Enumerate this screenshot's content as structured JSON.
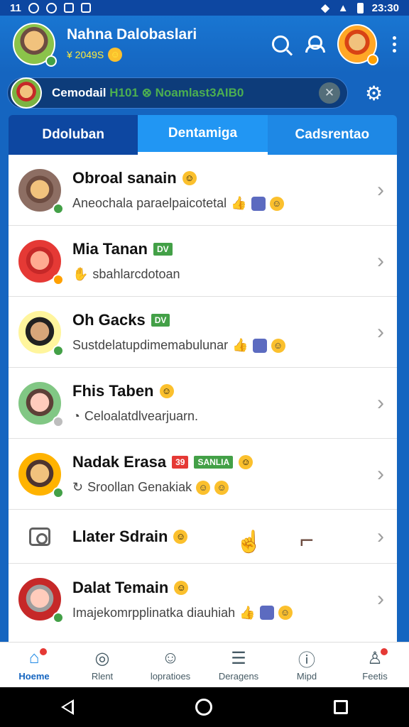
{
  "status_bar": {
    "left_text": "11",
    "time": "23:30"
  },
  "header": {
    "user_name": "Nahna Dalobaslari",
    "user_sub": "¥ 2049S",
    "icons": [
      "search-icon",
      "user-icon",
      "avatar",
      "kebab-menu-icon"
    ]
  },
  "banner": {
    "text_white": "Cemodail",
    "text_green": "H101 ⊗ Noamlast3AIB0",
    "close_glyph": "✕"
  },
  "tabs": [
    {
      "label": "Ddoluban"
    },
    {
      "label": "Dentamiga"
    },
    {
      "label": "Cadsrentao"
    }
  ],
  "chats": [
    {
      "title": "Obroal sanain",
      "subtitle": "Aneochala paraelpaicotetal"
    },
    {
      "title": "Mia Tanan",
      "tag": "DV",
      "subtitle": "sbahlarcdotoan"
    },
    {
      "title": "Oh Gacks",
      "tag": "DV",
      "subtitle": "Sustdelatupdimemabulunar"
    },
    {
      "title": "Fhis Taben",
      "subtitle": "Celoalatdlvearjuarn."
    },
    {
      "title": "Nadak Erasa",
      "tag_red": "39",
      "tag_green": "SANLIA",
      "subtitle": "Sroollan Genakiak"
    },
    {
      "title": "Llater Sdrain",
      "subtitle": ""
    },
    {
      "title": "Dalat Temain",
      "subtitle": "Imajekomrpplinatka diauhiah"
    }
  ],
  "bottom_nav": [
    {
      "label": "Hoeme"
    },
    {
      "label": "Rlent"
    },
    {
      "label": "lopratioes"
    },
    {
      "label": "Deragens"
    },
    {
      "label": "Mipd"
    },
    {
      "label": "Feetis"
    }
  ]
}
